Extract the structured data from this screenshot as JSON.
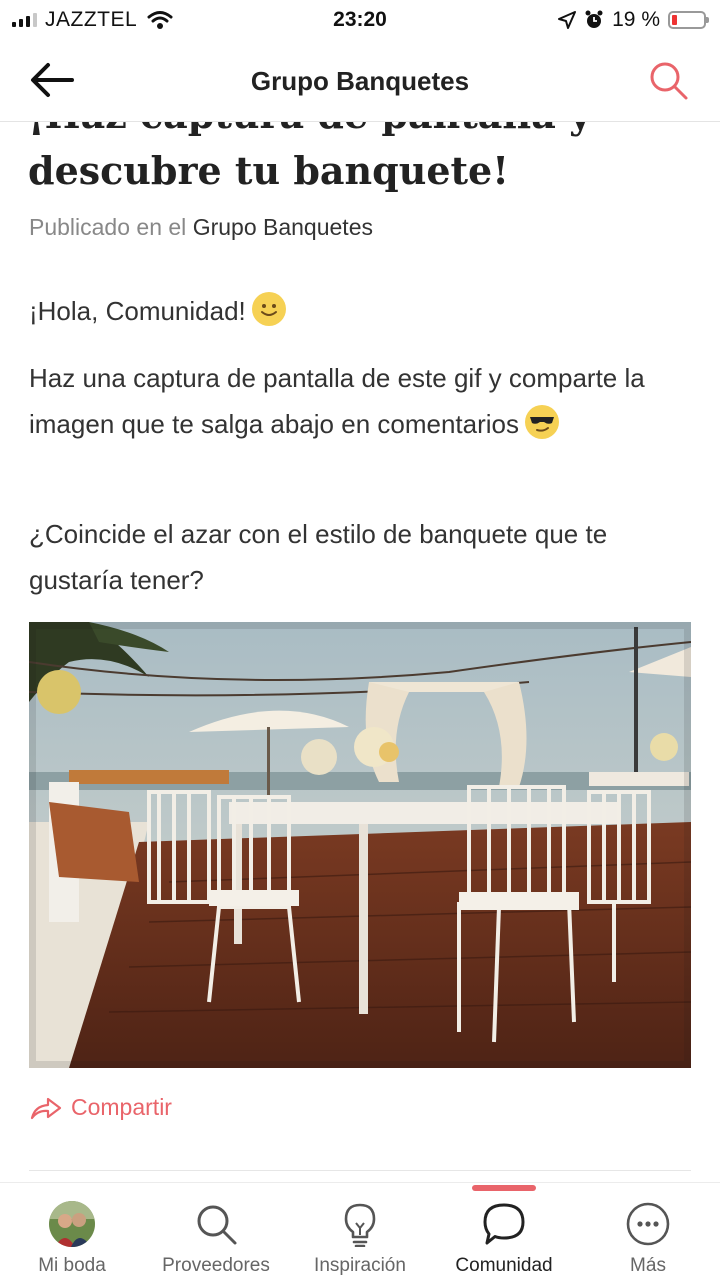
{
  "status_bar": {
    "carrier": "JAZZTEL",
    "time": "23:20",
    "battery": "19 %",
    "battery_level": 0.19
  },
  "nav": {
    "title": "Grupo Banquetes",
    "back_icon": "arrow-left-icon",
    "search_icon": "search-icon"
  },
  "post": {
    "title_line_partial": "¡Haz captura de pantalla y",
    "title_line": "descubre tu banquete!",
    "published_prefix": "Publicado en el",
    "published_group": "Grupo Banquetes",
    "greeting": "¡Hola, Comunidad!",
    "body_1": "Haz una captura de pantalla de este gif y comparte la imagen que te salga abajo en comentarios",
    "body_2": "¿Coincide el azar con el estilo de banquete que te gustaría tener?",
    "share_label": "Compartir"
  },
  "tabs": [
    {
      "label": "Mi boda",
      "icon": "avatar"
    },
    {
      "label": "Proveedores",
      "icon": "search-icon"
    },
    {
      "label": "Inspiración",
      "icon": "lightbulb-icon"
    },
    {
      "label": "Comunidad",
      "icon": "chat-bubble-icon",
      "active": true
    },
    {
      "label": "Más",
      "icon": "more-icon"
    }
  ],
  "colors": {
    "accent": "#e9646a",
    "text": "#222222",
    "muted": "#888888"
  }
}
